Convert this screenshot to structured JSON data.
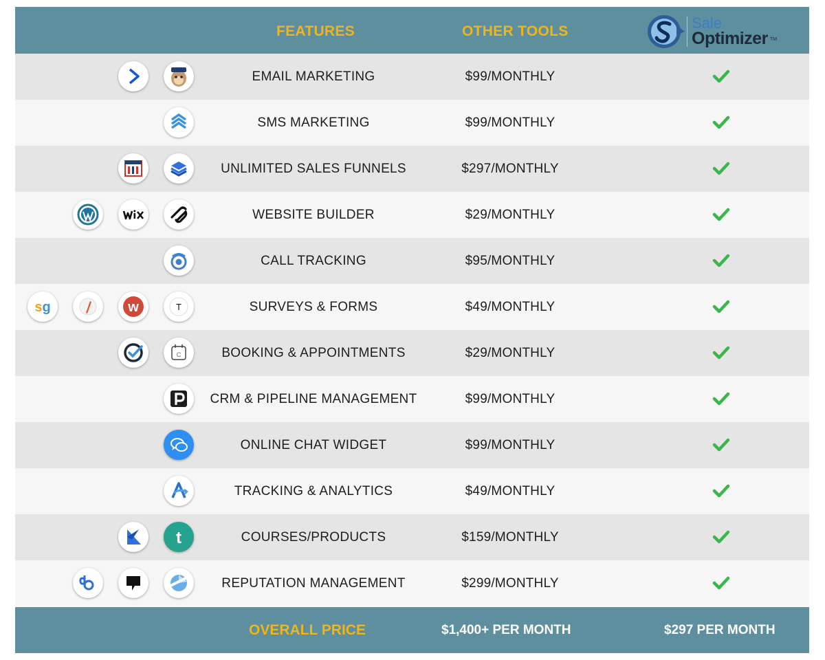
{
  "header": {
    "features_label": "FEATURES",
    "other_tools_label": "OTHER TOOLS",
    "brand_line1": "Sale",
    "brand_line2": "Optimizer",
    "brand_tm": "TM"
  },
  "rows": [
    {
      "feature": "EMAIL MARKETING",
      "price": "$99/MONTHLY",
      "icons": [
        "activecampaign-icon",
        "mailchimp-icon"
      ]
    },
    {
      "feature": "SMS MARKETING",
      "price": "$99/MONTHLY",
      "icons": [
        "sms-layers-icon"
      ]
    },
    {
      "feature": "UNLIMITED SALES FUNNELS",
      "price": "$297/MONTHLY",
      "icons": [
        "clickfunnels-icon",
        "leadpages-icon"
      ]
    },
    {
      "feature": "WEBSITE BUILDER",
      "price": "$29/MONTHLY",
      "icons": [
        "wordpress-icon",
        "wix-icon",
        "squarespace-icon"
      ]
    },
    {
      "feature": "CALL TRACKING",
      "price": "$95/MONTHLY",
      "icons": [
        "call-tracking-icon"
      ]
    },
    {
      "feature": "SURVEYS & FORMS",
      "price": "$49/MONTHLY",
      "icons": [
        "surveygizmo-icon",
        "pencil-icon",
        "wufoo-icon",
        "typeform-icon"
      ]
    },
    {
      "feature": "BOOKING & APPOINTMENTS",
      "price": "$29/MONTHLY",
      "icons": [
        "check-circle-icon",
        "calendar-icon"
      ]
    },
    {
      "feature": "CRM & PIPELINE MANAGEMENT",
      "price": "$99/MONTHLY",
      "icons": [
        "pipedrive-icon"
      ]
    },
    {
      "feature": "ONLINE CHAT WIDGET",
      "price": "$99/MONTHLY",
      "icons": [
        "chat-bubbles-icon"
      ]
    },
    {
      "feature": "TRACKING & ANALYTICS",
      "price": "$49/MONTHLY",
      "icons": [
        "analytics-icon"
      ]
    },
    {
      "feature": "COURSES/PRODUCTS",
      "price": "$159/MONTHLY",
      "icons": [
        "kajabi-icon",
        "teachable-icon"
      ]
    },
    {
      "feature": "REPUTATION MANAGEMENT",
      "price": "$299/MONTHLY",
      "icons": [
        "birdeye-icon",
        "podium-icon",
        "reputation-icon"
      ]
    }
  ],
  "footer": {
    "overall_label": "OVERALL PRICE",
    "other_tools_total": "$1,400+ PER MONTH",
    "sale_optimizer_total": "$297 PER MONTH"
  },
  "colors": {
    "header_bg": "#5e8f9e",
    "accent_gold": "#f1b51c",
    "check_green": "#3cb54a",
    "row_dark": "#e5e5e5",
    "row_light": "#f6f6f6"
  }
}
